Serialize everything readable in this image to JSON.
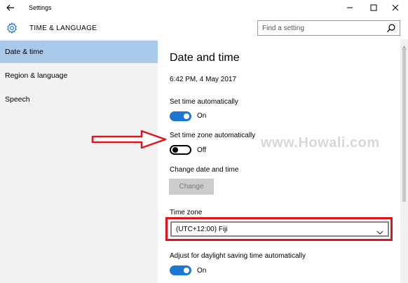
{
  "window": {
    "title": "Settings",
    "controls": [
      "minimize",
      "maximize",
      "close"
    ]
  },
  "header": {
    "title": "TIME & LANGUAGE",
    "search_placeholder": "Find a setting"
  },
  "sidebar": {
    "items": [
      {
        "label": "Date & time",
        "active": true
      },
      {
        "label": "Region & language",
        "active": false
      },
      {
        "label": "Speech",
        "active": false
      }
    ]
  },
  "main": {
    "page_title": "Date and time",
    "current_datetime": "6:42 PM,  4 May 2017",
    "set_time_auto": {
      "label": "Set time automatically",
      "state": "On"
    },
    "set_timezone_auto": {
      "label": "Set time zone automatically",
      "state": "Off"
    },
    "change_datetime": {
      "label": "Change date and time",
      "button": "Change"
    },
    "time_zone": {
      "label": "Time zone",
      "value": "(UTC+12:00) Fiji"
    },
    "daylight_saving": {
      "label": "Adjust for daylight saving time automatically",
      "state": "On"
    }
  },
  "annotations": {
    "watermark": "www.Howali.com",
    "arrow_color": "#e2141b",
    "highlight_color": "#e2141b"
  },
  "colors": {
    "accent": "#1c76d2",
    "sidebar_bg": "#f2f2f2",
    "active_item_bg": "#a9c9eb"
  }
}
